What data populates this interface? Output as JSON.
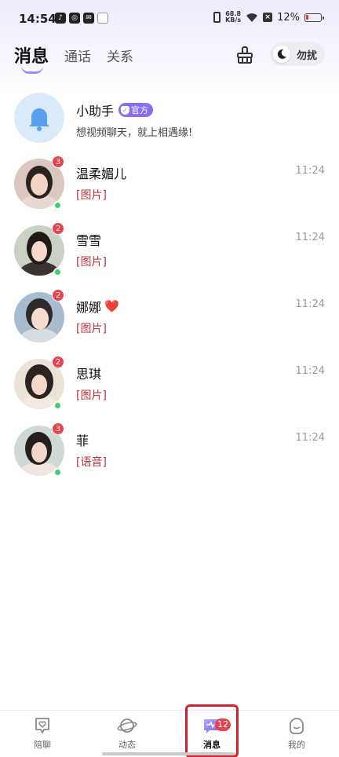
{
  "status_bar": {
    "time": "14:54",
    "net_speed_value": "68.8",
    "net_speed_unit": "KB/s",
    "battery": "12%"
  },
  "header": {
    "tabs": [
      {
        "label": "消息",
        "active": true
      },
      {
        "label": "通话",
        "active": false
      },
      {
        "label": "关系",
        "active": false
      }
    ],
    "dnd_label": "勿扰"
  },
  "assistant": {
    "name": "小助手",
    "tag": "官方",
    "preview": "想视频聊天，就上相遇缘!"
  },
  "chats": [
    {
      "name": "温柔媚儿",
      "preview": "[图片]",
      "time": "11:24",
      "unread": "3",
      "online": true
    },
    {
      "name": "雪雪",
      "preview": "[图片]",
      "time": "11:24",
      "unread": "2",
      "online": true
    },
    {
      "name": "娜娜",
      "emoji": "❤️",
      "preview": "[图片]",
      "time": "11:24",
      "unread": "2",
      "online": false
    },
    {
      "name": "思琪",
      "preview": "[图片]",
      "time": "11:24",
      "unread": "2",
      "online": true
    },
    {
      "name": "菲",
      "preview": "[语音]",
      "time": "11:24",
      "unread": "3",
      "online": true
    }
  ],
  "bottom_nav": {
    "items": [
      {
        "label": "陪聊",
        "icon": "heart-chat-icon"
      },
      {
        "label": "动态",
        "icon": "planet-icon"
      },
      {
        "label": "消息",
        "icon": "message-icon",
        "badge": "12",
        "active": true
      },
      {
        "label": "我的",
        "icon": "profile-icon"
      }
    ]
  },
  "colors": {
    "accent": "#8a6cf6",
    "badge": "#e8424a",
    "online": "#3dd16b",
    "preview_red": "#c0343c"
  }
}
